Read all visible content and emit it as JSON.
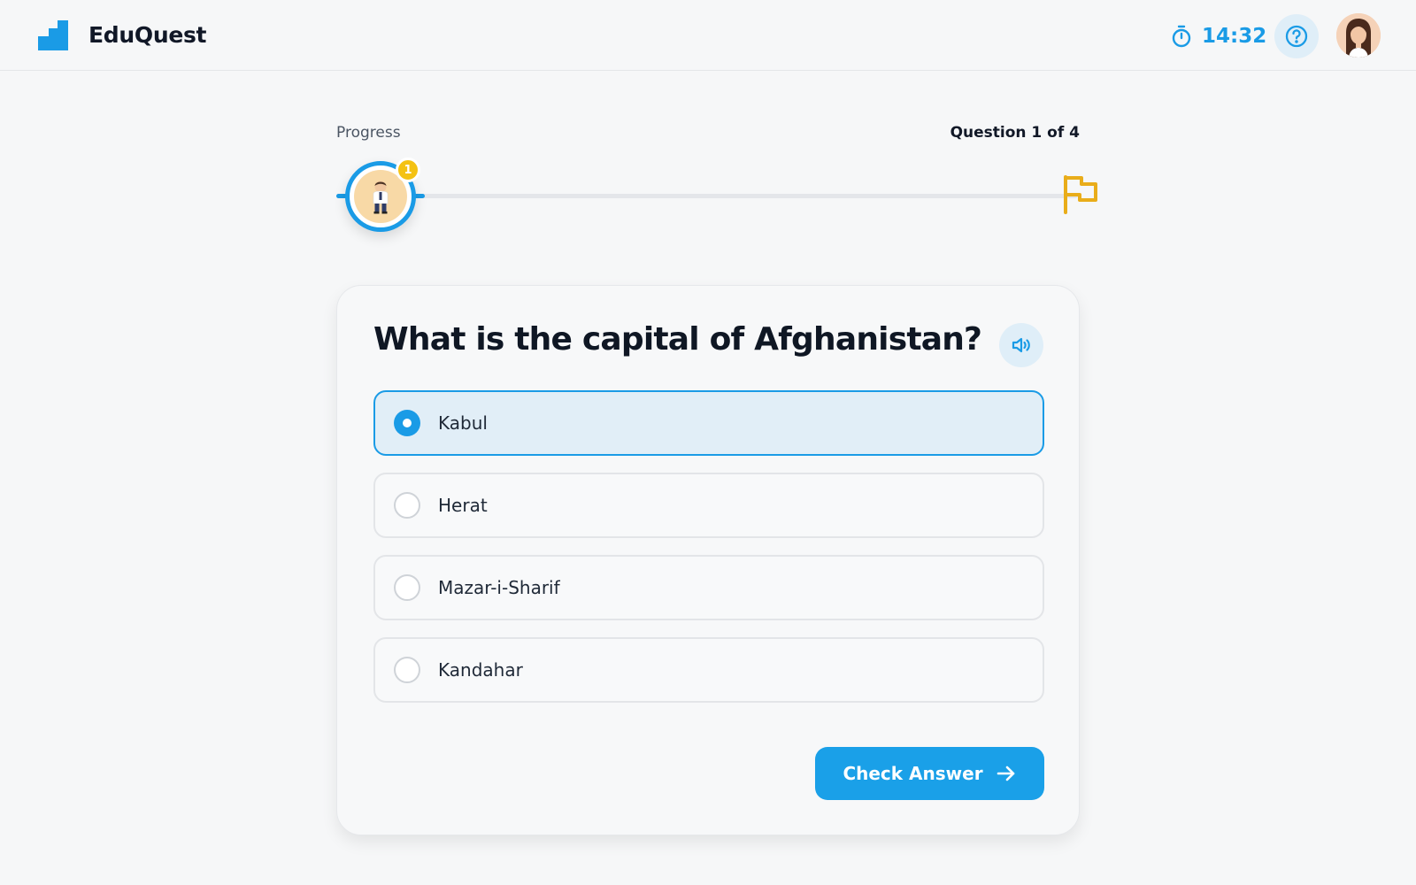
{
  "header": {
    "brand": "EduQuest",
    "timer": "14:32"
  },
  "progress": {
    "label": "Progress",
    "question_count": "Question 1 of 4",
    "current": 1,
    "total": 4,
    "badge": "1"
  },
  "quiz": {
    "question": "What is the capital of Afghanistan?",
    "options": [
      {
        "label": "Kabul",
        "selected": true
      },
      {
        "label": "Herat",
        "selected": false
      },
      {
        "label": "Mazar-i-Sharif",
        "selected": false
      },
      {
        "label": "Kandahar",
        "selected": false
      }
    ],
    "submit_label": "Check Answer"
  },
  "colors": {
    "accent": "#1a9be6",
    "flag": "#e9ad1a",
    "badge": "#f4c213"
  },
  "icons": [
    "logo-icon",
    "timer-icon",
    "help-icon",
    "avatar",
    "flag-icon",
    "speaker-icon",
    "arrow-right-icon"
  ]
}
